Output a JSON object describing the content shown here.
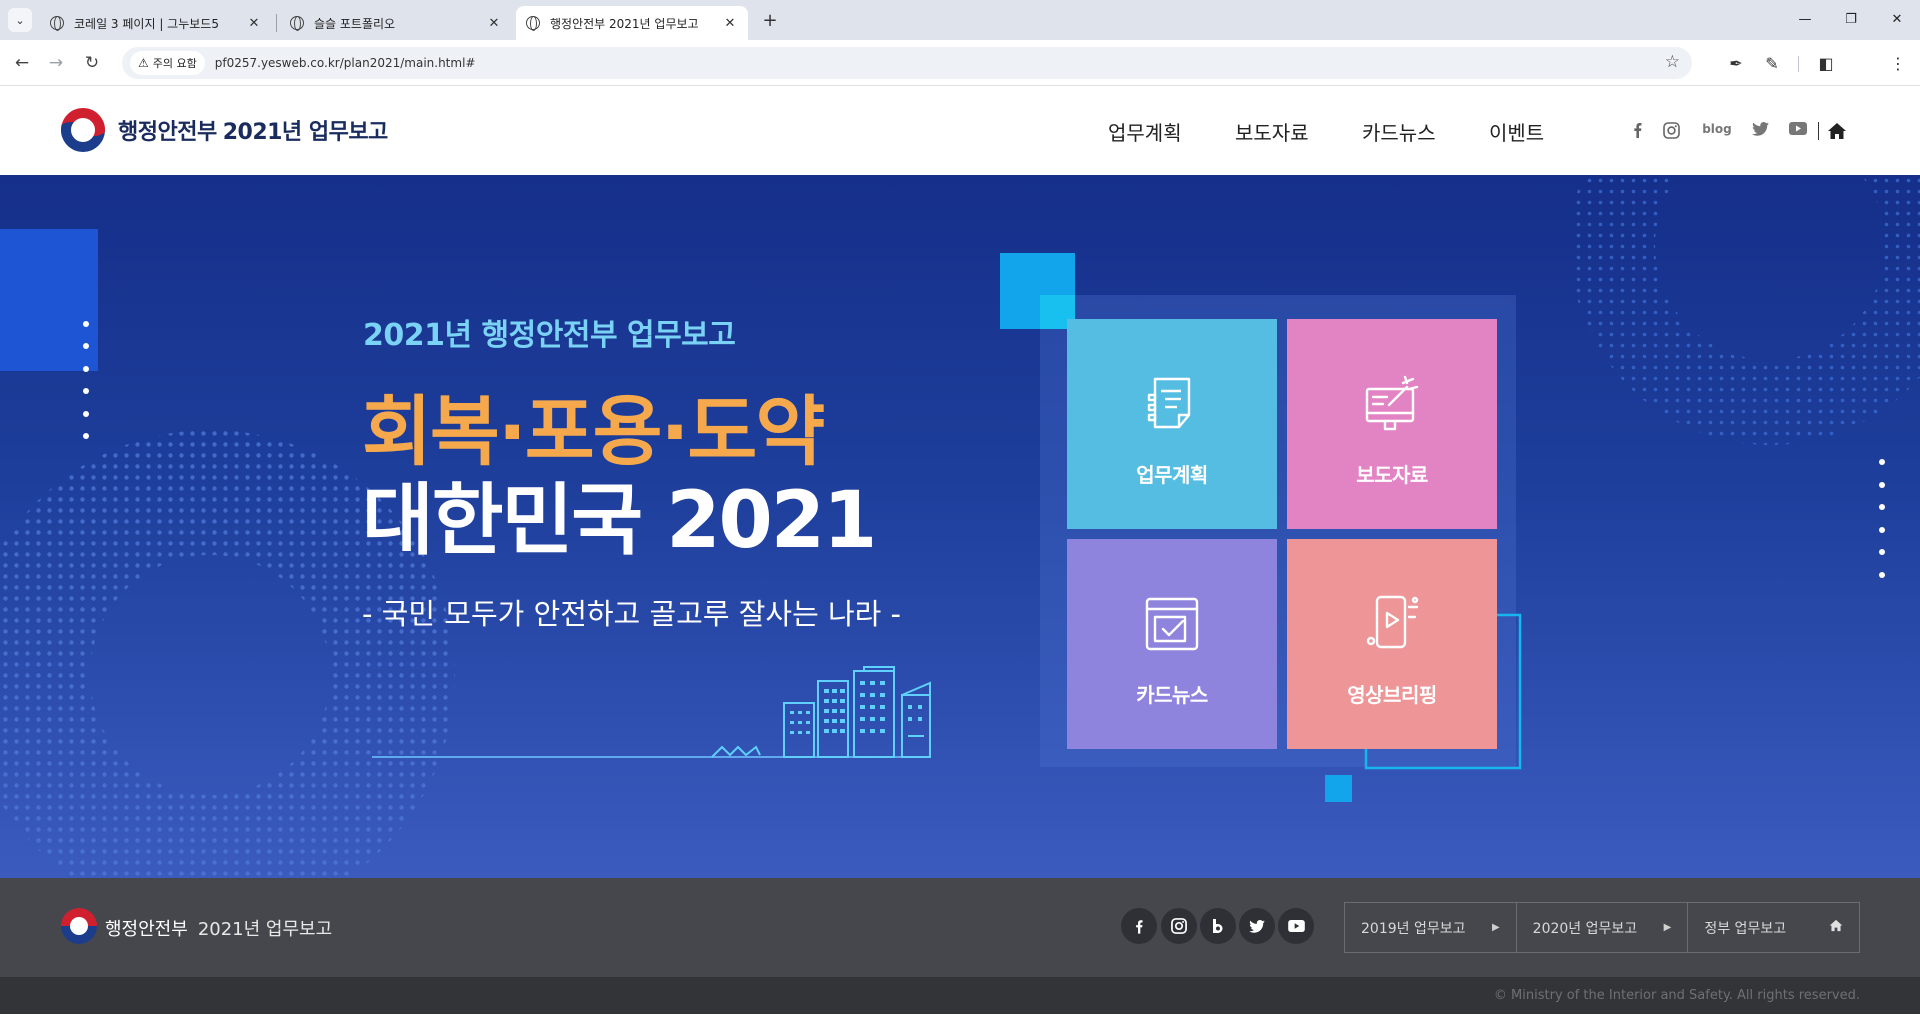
{
  "browser": {
    "tabs": [
      {
        "title": "코레일 3 페이지 | 그누보드5",
        "active": false
      },
      {
        "title": "슬슬 포트폴리오",
        "active": false
      },
      {
        "title": "행정안전부 2021년 업무보고",
        "active": true
      }
    ],
    "new_tab_glyph": "+",
    "security_chip": "주의 요함",
    "url": "pf0257.yesweb.co.kr/plan2021/main.html#",
    "window_controls": [
      "minimize",
      "restore",
      "close"
    ]
  },
  "header": {
    "brand_name": "행정안전부",
    "brand_year": "2021년 업무보고",
    "nav": [
      "업무계획",
      "보도자료",
      "카드뉴스",
      "이벤트"
    ],
    "sns": [
      "facebook-icon",
      "instagram-icon",
      "blog",
      "twitter-icon",
      "youtube-icon",
      "home-icon"
    ],
    "blog_label": "blog"
  },
  "hero": {
    "subtitle": "2021년 행정안전부 업무보고",
    "title_line1": "회복·포용·도약",
    "title_line2": "대한민국 2021",
    "slogan": "- 국민 모두가 안전하고 골고루 잘사는 나라 -",
    "tiles": [
      {
        "label": "업무계획",
        "color": "#55bde2",
        "icon": "document-icon"
      },
      {
        "label": "보도자료",
        "color": "#e283c4",
        "icon": "press-icon"
      },
      {
        "label": "카드뉴스",
        "color": "#8e84de",
        "icon": "card-news-icon"
      },
      {
        "label": "영상브리핑",
        "color": "#ed9597",
        "icon": "video-icon"
      }
    ]
  },
  "footer": {
    "brand_name": "행정안전부",
    "brand_year": "2021년 업무보고",
    "sns": [
      "facebook-icon",
      "instagram-icon",
      "blog-icon",
      "twitter-icon",
      "youtube-icon"
    ],
    "links": [
      {
        "label": "2019년 업무보고",
        "icon": "arrow-right-icon"
      },
      {
        "label": "2020년 업무보고",
        "icon": "arrow-right-icon"
      },
      {
        "label": "정부 업무보고",
        "icon": "home-icon"
      }
    ],
    "copyright": "© Ministry of the Interior and Safety. All rights reserved."
  },
  "colors": {
    "hero_top": "#152f8a",
    "hero_bottom": "#3b5bbf",
    "hero_subtitle": "#7ad3f5",
    "hero_title_accent": "#f5a94c",
    "footer_bg": "#45474d"
  }
}
